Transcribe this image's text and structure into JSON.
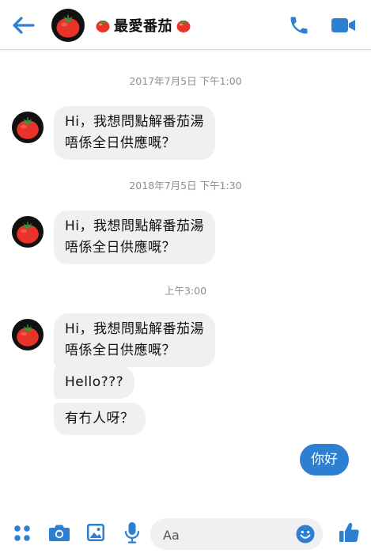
{
  "header": {
    "title": "最愛番茄",
    "back_icon": "arrow-left-icon",
    "call_icon": "phone-icon",
    "video_icon": "video-camera-icon",
    "accent_color": "#2c7fd1"
  },
  "messages": {
    "t1": "2017年7月5日 下午1:00",
    "m1": "Hi，我想問點解番茄湯\n唔係全日供應嘅？",
    "t2": "2018年7月5日 下午1:30",
    "m2": "Hi，我想問點解番茄湯\n唔係全日供應嘅？",
    "t3": "上午3:00",
    "m3": "Hi，我想問點解番茄湯\n唔係全日供應嘅？",
    "m4": "Hello???",
    "m5": "有冇人呀？",
    "reply": "你好"
  },
  "composer": {
    "placeholder": "Aa",
    "icons": [
      "apps-icon",
      "camera-icon",
      "image-icon",
      "microphone-icon",
      "emoji-icon",
      "thumbs-up-icon"
    ]
  }
}
